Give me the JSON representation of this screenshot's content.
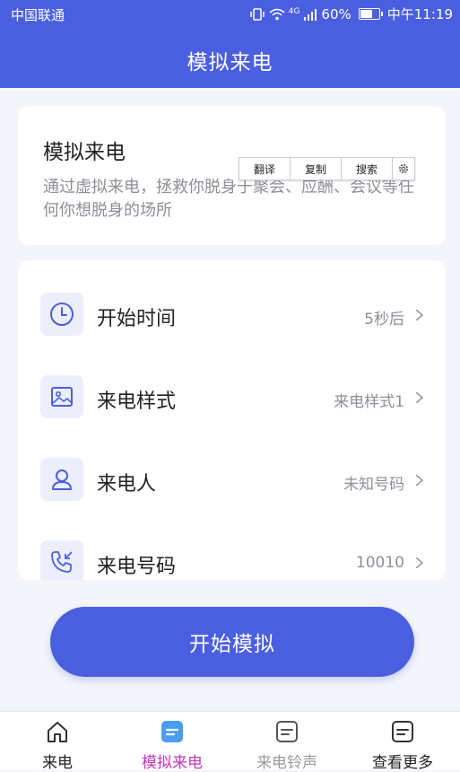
{
  "status_bar": {
    "carrier": "中国联通",
    "network": "4G",
    "battery": "60%",
    "time": "中午11:19"
  },
  "header": {
    "title": "模拟来电"
  },
  "intro": {
    "title": "模拟来电",
    "description": "通过虚拟来电，拯救你脱身于聚会、应酬、会议等任何你想脱身的场所"
  },
  "context_menu": {
    "translate": "翻译",
    "copy": "复制",
    "search": "搜索"
  },
  "settings": {
    "start_time": {
      "label": "开始时间",
      "value": "5秒后"
    },
    "call_style": {
      "label": "来电样式",
      "value": "来电样式1"
    },
    "caller": {
      "label": "来电人",
      "value": "未知号码"
    },
    "number": {
      "label": "来电号码",
      "value": "10010"
    }
  },
  "start_button": {
    "label": "开始模拟"
  },
  "tabs": [
    {
      "label": "来电",
      "icon": "home-icon",
      "state": "normal"
    },
    {
      "label": "模拟来电",
      "icon": "document-icon",
      "state": "active"
    },
    {
      "label": "来电铃声",
      "icon": "document-icon",
      "state": "muted"
    },
    {
      "label": "查看更多",
      "icon": "document-icon",
      "state": "normal"
    }
  ],
  "colors": {
    "primary": "#4a5fe0",
    "active_tab": "#c338b8",
    "muted_tab": "#9b9ba3",
    "text_dark": "#222222",
    "text_secondary": "#8d8f99"
  }
}
